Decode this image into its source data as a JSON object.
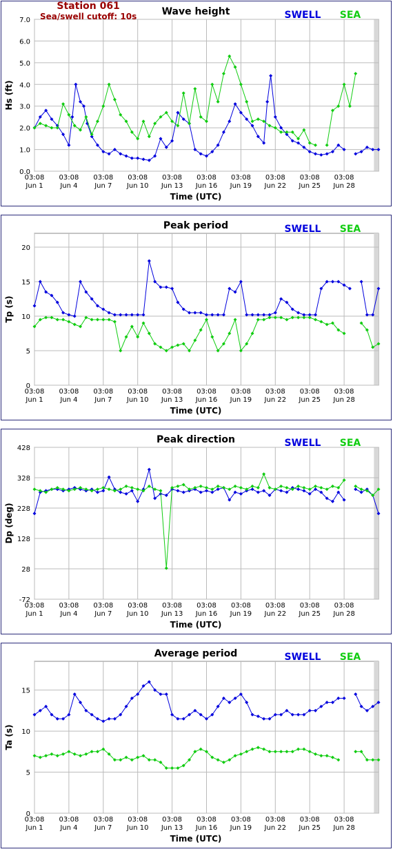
{
  "station": {
    "name": "Station 061",
    "cutoff": "Sea/swell cutoff: 10s"
  },
  "legend": {
    "swell": "SWELL",
    "sea": "SEA"
  },
  "colors": {
    "swell": "#0000dd",
    "sea": "#11cc11",
    "plot_bg": "#d8d8d8",
    "frame": "#2a2a7a",
    "station": "#990000"
  },
  "x_axis": {
    "label": "Time (UTC)",
    "ticks": [
      {
        "day": 0,
        "time": "03:08",
        "date": "Jun 1"
      },
      {
        "day": 3,
        "time": "03:08",
        "date": "Jun 4"
      },
      {
        "day": 6,
        "time": "03:08",
        "date": "Jun 7"
      },
      {
        "day": 9,
        "time": "03:08",
        "date": "Jun 10"
      },
      {
        "day": 12,
        "time": "03:08",
        "date": "Jun 13"
      },
      {
        "day": 15,
        "time": "03:08",
        "date": "Jun 16"
      },
      {
        "day": 18,
        "time": "03:08",
        "date": "Jun 19"
      },
      {
        "day": 21,
        "time": "03:08",
        "date": "Jun 22"
      },
      {
        "day": 24,
        "time": "03:08",
        "date": "Jun 25"
      },
      {
        "day": 27,
        "time": "03:08",
        "date": "Jun 28"
      }
    ],
    "range": [
      0,
      30
    ]
  },
  "chart_data": [
    {
      "type": "line",
      "title": "Wave height",
      "ylabel": "Hs (ft)",
      "ylim": [
        0,
        7
      ],
      "yticks": [
        "0.0",
        "1.0",
        "2.0",
        "3.0",
        "4.0",
        "5.0",
        "6.0",
        "7.0"
      ],
      "grid": true,
      "series": [
        {
          "name": "SWELL",
          "x": [
            0,
            0.5,
            1,
            1.5,
            2,
            2.5,
            3,
            3.3,
            3.6,
            4,
            4.3,
            4.6,
            5,
            5.5,
            6,
            6.5,
            7,
            7.5,
            8,
            8.5,
            9,
            9.5,
            10,
            10.5,
            11,
            11.5,
            12,
            12.5,
            13,
            13.5,
            14,
            14.5,
            15,
            15.5,
            16,
            16.5,
            17,
            17.5,
            18,
            18.5,
            19,
            19.5,
            20,
            20.3,
            20.6,
            21,
            21.5,
            22,
            22.5,
            23,
            23.5,
            24,
            24.5,
            25,
            25.5,
            26,
            26.5,
            27,
            27.5,
            28,
            28.5,
            29,
            29.5,
            30
          ],
          "values": [
            2.0,
            2.5,
            2.8,
            2.4,
            2.1,
            1.7,
            1.2,
            2.5,
            4.0,
            3.2,
            3.0,
            2.2,
            1.6,
            1.2,
            0.9,
            0.8,
            1.0,
            0.8,
            0.7,
            0.6,
            0.6,
            0.55,
            0.5,
            0.7,
            1.5,
            1.1,
            1.4,
            2.7,
            2.4,
            2.2,
            1.0,
            0.8,
            0.7,
            0.9,
            1.2,
            1.8,
            2.3,
            3.1,
            2.7,
            2.4,
            2.1,
            1.6,
            1.3,
            3.2,
            4.4,
            2.5,
            2.0,
            1.7,
            1.4,
            1.3,
            1.1,
            0.9,
            0.8,
            0.75,
            0.8,
            0.9,
            1.2,
            1.0,
            null,
            0.8,
            0.9,
            1.1,
            1.0,
            1.0
          ]
        },
        {
          "name": "SEA",
          "x": [
            0,
            0.5,
            1,
            1.5,
            2,
            2.5,
            3,
            3.5,
            4,
            4.5,
            5,
            5.5,
            6,
            6.5,
            7,
            7.5,
            8,
            8.5,
            9,
            9.5,
            10,
            10.5,
            11,
            11.5,
            12,
            12.5,
            13,
            13.5,
            14,
            14.5,
            15,
            15.5,
            16,
            16.5,
            17,
            17.5,
            18,
            18.5,
            19,
            19.5,
            20,
            20.5,
            21,
            21.5,
            22,
            22.5,
            23,
            23.5,
            24,
            24.5,
            25,
            25.5,
            26,
            26.5,
            27,
            27.5,
            28,
            28.5,
            29,
            29.5,
            30
          ],
          "values": [
            2.0,
            2.2,
            2.1,
            2.0,
            2.0,
            3.1,
            2.6,
            2.1,
            1.9,
            2.5,
            1.7,
            2.3,
            3.0,
            4.0,
            3.3,
            2.6,
            2.3,
            1.8,
            1.5,
            2.3,
            1.6,
            2.2,
            2.5,
            2.7,
            2.3,
            2.1,
            3.6,
            2.2,
            3.8,
            2.5,
            2.3,
            4.0,
            3.2,
            4.5,
            5.3,
            4.8,
            4.0,
            3.2,
            2.3,
            2.4,
            2.3,
            2.1,
            2.0,
            1.8,
            1.8,
            1.8,
            1.5,
            1.9,
            1.3,
            1.2,
            null,
            1.2,
            2.8,
            3.0,
            4.0,
            3.0,
            4.5,
            null,
            null,
            null,
            null
          ]
        }
      ]
    },
    {
      "type": "line",
      "title": "Peak period",
      "ylabel": "Tp (s)",
      "ylim": [
        0,
        22
      ],
      "yticks": [
        "0",
        "5",
        "10",
        "15",
        "20"
      ],
      "grid": true,
      "series": [
        {
          "name": "SWELL",
          "x": [
            0,
            0.5,
            1,
            1.5,
            2,
            2.5,
            3,
            3.5,
            4,
            4.5,
            5,
            5.5,
            6,
            6.5,
            7,
            7.5,
            8,
            8.5,
            9,
            9.5,
            10,
            10.5,
            11,
            11.5,
            12,
            12.5,
            13,
            13.5,
            14,
            14.5,
            15,
            15.5,
            16,
            16.5,
            17,
            17.5,
            18,
            18.5,
            19,
            19.5,
            20,
            20.5,
            21,
            21.5,
            22,
            22.5,
            23,
            23.5,
            24,
            24.5,
            25,
            25.5,
            26,
            26.5,
            27,
            27.5,
            28,
            28.5,
            29,
            29.5,
            30
          ],
          "values": [
            11.5,
            15.0,
            13.5,
            13.0,
            12.0,
            10.5,
            10.2,
            10.0,
            15.0,
            13.5,
            12.5,
            11.5,
            11.0,
            10.5,
            10.2,
            10.2,
            10.2,
            10.2,
            10.2,
            10.2,
            18.0,
            15.0,
            14.2,
            14.2,
            14.0,
            12.0,
            11.0,
            10.5,
            10.5,
            10.5,
            10.2,
            10.2,
            10.2,
            10.2,
            14.0,
            13.5,
            15.0,
            10.2,
            10.2,
            10.2,
            10.2,
            10.2,
            10.5,
            12.5,
            12.0,
            11.0,
            10.5,
            10.2,
            10.2,
            10.2,
            14.0,
            15.0,
            15.0,
            15.0,
            14.5,
            14.0,
            null,
            15.0,
            10.2,
            10.2,
            14.0
          ]
        },
        {
          "name": "SEA",
          "x": [
            0,
            0.5,
            1,
            1.5,
            2,
            2.5,
            3,
            3.5,
            4,
            4.5,
            5,
            5.5,
            6,
            6.5,
            7,
            7.5,
            8,
            8.5,
            9,
            9.5,
            10,
            10.5,
            11,
            11.5,
            12,
            12.5,
            13,
            13.5,
            14,
            14.5,
            15,
            15.5,
            16,
            16.5,
            17,
            17.5,
            18,
            18.5,
            19,
            19.5,
            20,
            20.5,
            21,
            21.5,
            22,
            22.5,
            23,
            23.5,
            24,
            24.5,
            25,
            25.5,
            26,
            26.5,
            27,
            27.5,
            28,
            28.5,
            29,
            29.5,
            30
          ],
          "values": [
            8.5,
            9.5,
            9.8,
            9.8,
            9.5,
            9.5,
            9.2,
            8.8,
            8.5,
            9.8,
            9.5,
            9.5,
            9.5,
            9.5,
            9.2,
            5.0,
            7.0,
            8.5,
            7.0,
            9.0,
            7.5,
            6.0,
            5.5,
            5.0,
            5.5,
            5.8,
            6.0,
            5.0,
            6.5,
            8.0,
            9.5,
            7.0,
            5.0,
            6.0,
            7.5,
            9.5,
            5.0,
            6.0,
            7.5,
            9.5,
            9.5,
            9.8,
            9.8,
            9.8,
            9.5,
            9.8,
            9.8,
            9.8,
            9.8,
            9.5,
            9.2,
            8.8,
            9.0,
            8.0,
            7.5,
            null,
            null,
            9.0,
            8.0,
            5.5,
            6.0
          ]
        }
      ]
    },
    {
      "type": "line",
      "title": "Peak direction",
      "ylabel": "Dp (deg)",
      "ylim": [
        -72,
        428
      ],
      "yticks": [
        "-72",
        "28",
        "128",
        "228",
        "328",
        "428"
      ],
      "grid": true,
      "series": [
        {
          "name": "SWELL",
          "x": [
            0,
            0.5,
            1,
            1.5,
            2,
            2.5,
            3,
            3.5,
            4,
            4.5,
            5,
            5.5,
            6,
            6.5,
            7,
            7.5,
            8,
            8.5,
            9,
            9.5,
            10,
            10.5,
            11,
            11.5,
            12,
            12.5,
            13,
            13.5,
            14,
            14.5,
            15,
            15.5,
            16,
            16.5,
            17,
            17.5,
            18,
            18.5,
            19,
            19.5,
            20,
            20.5,
            21,
            21.5,
            22,
            22.5,
            23,
            23.5,
            24,
            24.5,
            25,
            25.5,
            26,
            26.5,
            27,
            27.5,
            28,
            28.5,
            29,
            29.5,
            30
          ],
          "values": [
            210,
            280,
            285,
            290,
            290,
            285,
            290,
            295,
            290,
            285,
            290,
            280,
            285,
            330,
            290,
            280,
            275,
            285,
            250,
            290,
            355,
            260,
            275,
            270,
            290,
            285,
            280,
            285,
            290,
            280,
            285,
            280,
            290,
            295,
            255,
            280,
            275,
            285,
            290,
            280,
            285,
            270,
            290,
            285,
            280,
            295,
            290,
            285,
            275,
            290,
            280,
            260,
            250,
            280,
            255,
            null,
            290,
            280,
            290,
            270,
            210
          ]
        },
        {
          "name": "SEA",
          "x": [
            0,
            0.5,
            1,
            1.5,
            2,
            2.5,
            3,
            3.5,
            4,
            4.5,
            5,
            5.5,
            6,
            6.5,
            7,
            7.5,
            8,
            8.5,
            9,
            9.5,
            10,
            10.5,
            11,
            11.5,
            12,
            12.5,
            13,
            13.5,
            14,
            14.5,
            15,
            15.5,
            16,
            16.5,
            17,
            17.5,
            18,
            18.5,
            19,
            19.5,
            20,
            20.5,
            21,
            21.5,
            22,
            22.5,
            23,
            23.5,
            24,
            24.5,
            25,
            25.5,
            26,
            26.5,
            27,
            27.5,
            28,
            28.5,
            29,
            29.5,
            30
          ],
          "values": [
            290,
            285,
            280,
            290,
            295,
            290,
            285,
            290,
            295,
            290,
            285,
            290,
            295,
            290,
            285,
            290,
            300,
            295,
            290,
            285,
            300,
            290,
            285,
            30,
            295,
            300,
            305,
            290,
            295,
            300,
            295,
            290,
            300,
            295,
            290,
            300,
            295,
            290,
            300,
            295,
            340,
            295,
            290,
            300,
            295,
            290,
            300,
            295,
            290,
            300,
            295,
            290,
            300,
            295,
            320,
            null,
            300,
            290,
            285,
            270,
            290
          ]
        }
      ]
    },
    {
      "type": "line",
      "title": "Average period",
      "ylabel": "Ta (s)",
      "ylim": [
        0,
        18.5
      ],
      "yticks": [
        "0",
        "5",
        "10",
        "15"
      ],
      "grid": true,
      "series": [
        {
          "name": "SWELL",
          "x": [
            0,
            0.5,
            1,
            1.5,
            2,
            2.5,
            3,
            3.5,
            4,
            4.5,
            5,
            5.5,
            6,
            6.5,
            7,
            7.5,
            8,
            8.5,
            9,
            9.5,
            10,
            10.5,
            11,
            11.5,
            12,
            12.5,
            13,
            13.5,
            14,
            14.5,
            15,
            15.5,
            16,
            16.5,
            17,
            17.5,
            18,
            18.5,
            19,
            19.5,
            20,
            20.5,
            21,
            21.5,
            22,
            22.5,
            23,
            23.5,
            24,
            24.5,
            25,
            25.5,
            26,
            26.5,
            27,
            27.5,
            28,
            28.5,
            29,
            29.5,
            30
          ],
          "values": [
            12.0,
            12.5,
            13.0,
            12.0,
            11.5,
            11.5,
            12.0,
            14.5,
            13.5,
            12.5,
            12.0,
            11.5,
            11.2,
            11.5,
            11.5,
            12.0,
            13.0,
            14.0,
            14.5,
            15.5,
            16.0,
            15.0,
            14.5,
            14.5,
            12.0,
            11.5,
            11.5,
            12.0,
            12.5,
            12.0,
            11.5,
            12.0,
            13.0,
            14.0,
            13.5,
            14.0,
            14.5,
            13.5,
            12.0,
            11.8,
            11.5,
            11.5,
            12.0,
            12.0,
            12.5,
            12.0,
            12.0,
            12.0,
            12.5,
            12.5,
            13.0,
            13.5,
            13.5,
            14.0,
            14.0,
            null,
            14.5,
            13.0,
            12.5,
            13.0,
            13.5
          ]
        },
        {
          "name": "SEA",
          "x": [
            0,
            0.5,
            1,
            1.5,
            2,
            2.5,
            3,
            3.5,
            4,
            4.5,
            5,
            5.5,
            6,
            6.5,
            7,
            7.5,
            8,
            8.5,
            9,
            9.5,
            10,
            10.5,
            11,
            11.5,
            12,
            12.5,
            13,
            13.5,
            14,
            14.5,
            15,
            15.5,
            16,
            16.5,
            17,
            17.5,
            18,
            18.5,
            19,
            19.5,
            20,
            20.5,
            21,
            21.5,
            22,
            22.5,
            23,
            23.5,
            24,
            24.5,
            25,
            25.5,
            26,
            26.5,
            27,
            27.5,
            28,
            28.5,
            29,
            29.5,
            30
          ],
          "values": [
            7.0,
            6.8,
            7.0,
            7.2,
            7.0,
            7.2,
            7.5,
            7.2,
            7.0,
            7.2,
            7.5,
            7.5,
            7.8,
            7.2,
            6.5,
            6.5,
            6.8,
            6.5,
            6.8,
            7.0,
            6.5,
            6.5,
            6.2,
            5.5,
            5.5,
            5.5,
            5.8,
            6.5,
            7.5,
            7.8,
            7.5,
            6.8,
            6.5,
            6.2,
            6.5,
            7.0,
            7.2,
            7.5,
            7.8,
            8.0,
            7.8,
            7.5,
            7.5,
            7.5,
            7.5,
            7.5,
            7.8,
            7.8,
            7.5,
            7.2,
            7.0,
            7.0,
            6.8,
            6.5,
            null,
            null,
            7.5,
            7.5,
            6.5,
            6.5,
            6.5
          ]
        }
      ]
    }
  ]
}
